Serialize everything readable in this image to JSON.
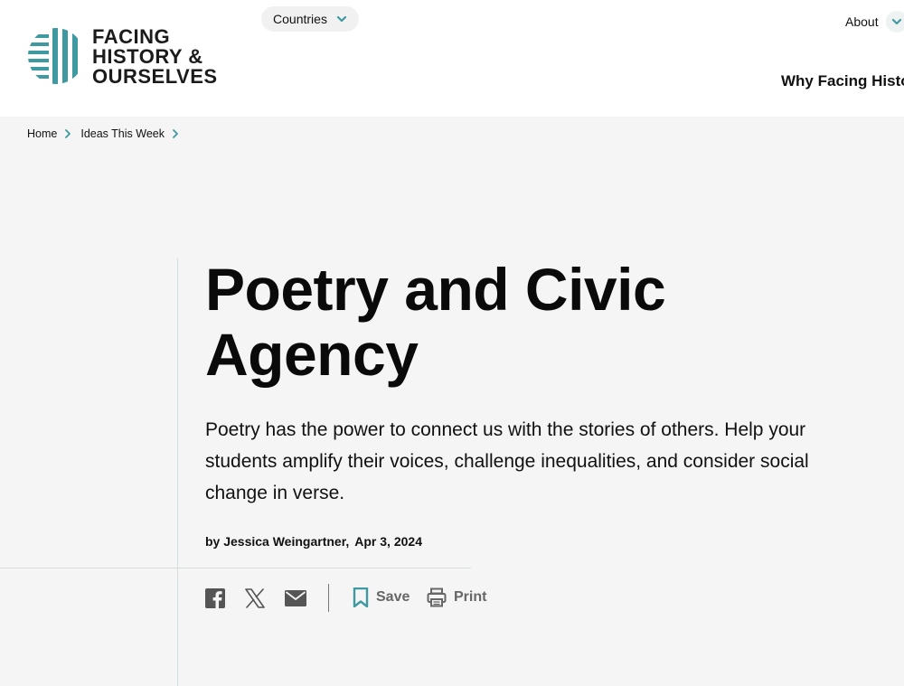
{
  "header": {
    "logo_lines": [
      "FACING",
      "HISTORY &",
      "OURSELVES"
    ],
    "countries_label": "Countries",
    "about_label": "About",
    "why_label": "Why Facing Histo"
  },
  "breadcrumb": {
    "items": [
      "Home",
      "Ideas This Week"
    ]
  },
  "article": {
    "title": "Poetry and Civic Agency",
    "intro": "Poetry has the power to connect us with the stories of others. Help your students amplify their voices, challenge inequalities, and consider social change in verse.",
    "author": "by Jessica Weingartner,",
    "date": "Apr 3, 2024"
  },
  "share": {
    "icons": [
      "facebook-icon",
      "x-icon",
      "email-icon"
    ],
    "save_label": "Save",
    "print_label": "Print"
  },
  "colors": {
    "brand_teal": "#3e9aa0",
    "header_bg": "#ffffff",
    "page_bg": "#f5f5f5",
    "muted_text": "#666666"
  }
}
